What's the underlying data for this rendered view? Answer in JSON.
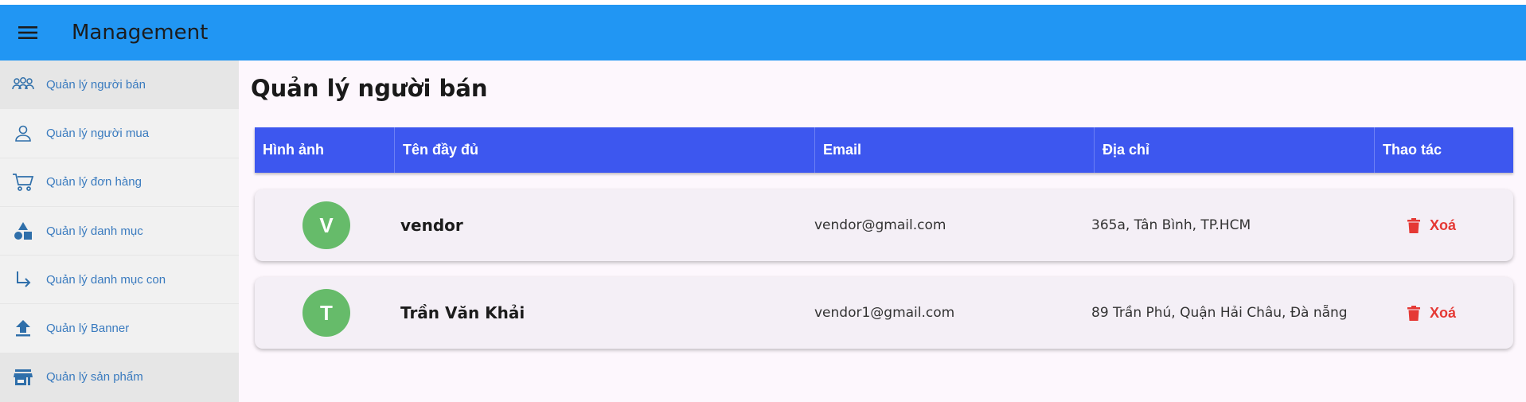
{
  "appbar": {
    "title": "Management",
    "menu_icon": "menu-icon",
    "color": "#2196f3"
  },
  "sidebar": {
    "items": [
      {
        "label": "Quản lý người bán",
        "icon": "group-icon"
      },
      {
        "label": "Quản lý người mua",
        "icon": "person-icon"
      },
      {
        "label": "Quản lý đơn hàng",
        "icon": "cart-icon"
      },
      {
        "label": "Quản lý danh mục",
        "icon": "category-icon"
      },
      {
        "label": "Quản lý danh mục con",
        "icon": "subdirectory-arrow-icon"
      },
      {
        "label": "Quản lý Banner",
        "icon": "upload-icon"
      },
      {
        "label": "Quản lý sản phẩm",
        "icon": "store-icon"
      }
    ]
  },
  "main": {
    "title": "Quản lý người bán",
    "table": {
      "headers": [
        "Hình ảnh",
        "Tên đầy đủ",
        "Email",
        "Địa chỉ",
        "Thao tác"
      ],
      "header_color": "#3d57ef",
      "rows": [
        {
          "initial": "V",
          "name": "vendor",
          "email": "vendor@gmail.com",
          "address": "365a, Tân Bình, TP.HCM",
          "action": "Xoá"
        },
        {
          "initial": "T",
          "name": "Trần Văn Khải",
          "email": "vendor1@gmail.com",
          "address": "89 Trần Phú, Quận Hải Châu, Đà nẵng",
          "action": "Xoá"
        }
      ]
    }
  }
}
